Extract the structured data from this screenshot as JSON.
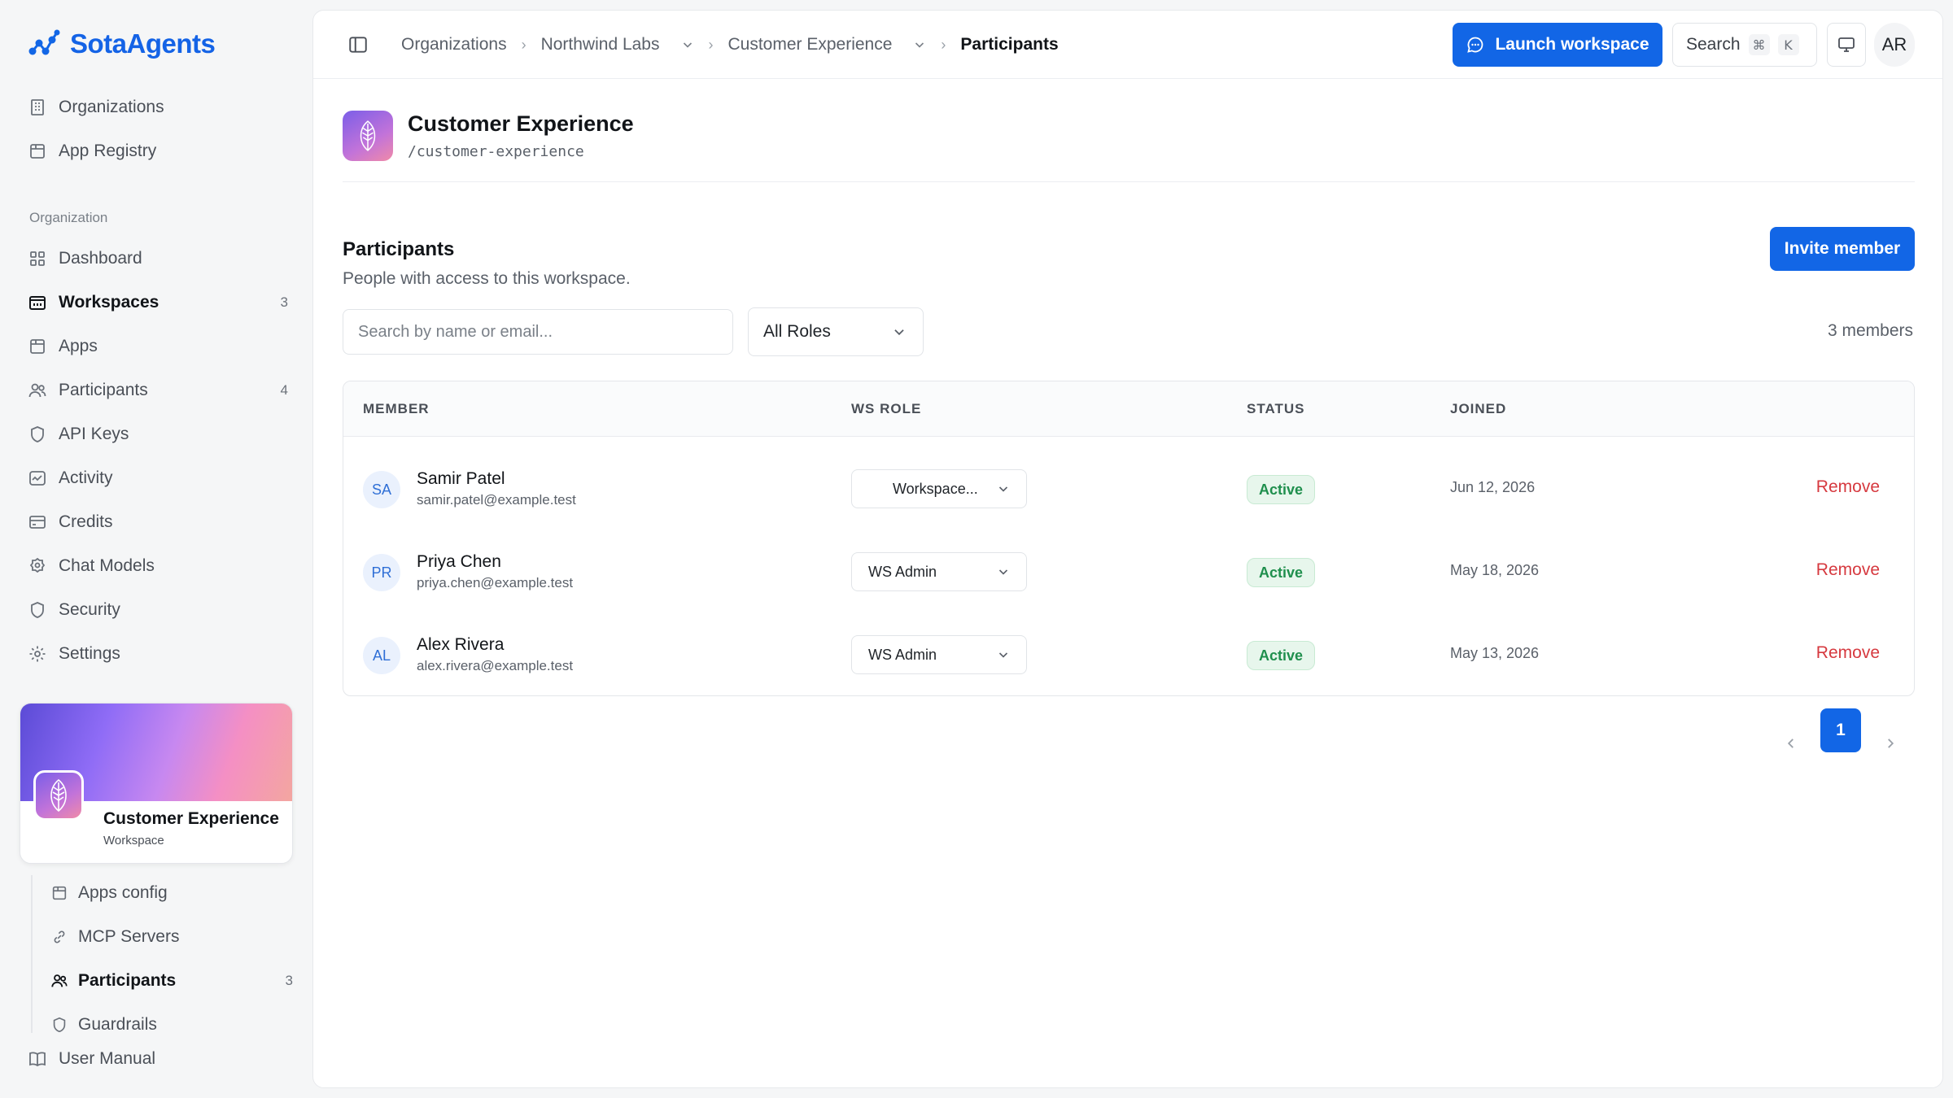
{
  "brand": {
    "name": "SotaAgents",
    "accent": "#1266e6"
  },
  "sidebar": {
    "top_items": [
      {
        "label": "Organizations",
        "icon": "building-icon"
      },
      {
        "label": "App Registry",
        "icon": "package-icon"
      }
    ],
    "section_label": "Organization",
    "items": [
      {
        "label": "Dashboard",
        "icon": "grid-icon",
        "count": ""
      },
      {
        "label": "Workspaces",
        "icon": "folder-icon",
        "count": "3",
        "active": true
      },
      {
        "label": "Apps",
        "icon": "package-icon",
        "count": ""
      },
      {
        "label": "Participants",
        "icon": "users-icon",
        "count": "4"
      },
      {
        "label": "API Keys",
        "icon": "shield-icon",
        "count": ""
      },
      {
        "label": "Activity",
        "icon": "activity-icon",
        "count": ""
      },
      {
        "label": "Credits",
        "icon": "credit-card-icon",
        "count": ""
      },
      {
        "label": "Chat Models",
        "icon": "model-icon",
        "count": ""
      },
      {
        "label": "Security",
        "icon": "shield-icon",
        "count": ""
      },
      {
        "label": "Settings",
        "icon": "gear-icon",
        "count": ""
      }
    ],
    "workspace_card": {
      "name": "Customer Experience",
      "type": "Workspace"
    },
    "sub_items": [
      {
        "label": "Apps config",
        "icon": "package-icon",
        "count": ""
      },
      {
        "label": "MCP Servers",
        "icon": "link-icon",
        "count": ""
      },
      {
        "label": "Participants",
        "icon": "users-icon",
        "count": "3",
        "active": true
      },
      {
        "label": "Guardrails",
        "icon": "shield-icon",
        "count": ""
      }
    ],
    "manual_label": "User Manual"
  },
  "topbar": {
    "breadcrumbs": [
      "Organizations",
      "Northwind Labs",
      "Customer Experience",
      "Participants"
    ],
    "launch_label": "Launch workspace",
    "search_label": "Search",
    "search_kbd": [
      "⌘",
      "K"
    ],
    "avatar_initials": "AR"
  },
  "workspace": {
    "title": "Customer Experience",
    "slug": "/customer-experience"
  },
  "participants": {
    "title": "Participants",
    "subtitle": "People with access to this workspace.",
    "invite_label": "Invite member",
    "search_placeholder": "Search by name or email...",
    "role_filter": "All Roles",
    "member_count": "3 members",
    "columns": [
      "MEMBER",
      "WS ROLE",
      "STATUS",
      "JOINED"
    ],
    "rows": [
      {
        "initials": "SA",
        "name": "Samir Patel",
        "email": "samir.patel@example.test",
        "role": "Workspace...",
        "status": "Active",
        "joined": "Jun 12, 2026",
        "action": "Remove"
      },
      {
        "initials": "PR",
        "name": "Priya Chen",
        "email": "priya.chen@example.test",
        "role": "WS Admin",
        "status": "Active",
        "joined": "May 18, 2026",
        "action": "Remove"
      },
      {
        "initials": "AL",
        "name": "Alex Rivera",
        "email": "alex.rivera@example.test",
        "role": "WS Admin",
        "status": "Active",
        "joined": "May 13, 2026",
        "action": "Remove"
      }
    ],
    "pagination": {
      "current_page": "1"
    }
  },
  "colors": {
    "status_active": "#1f8f4d",
    "remove": "#d6393f"
  }
}
